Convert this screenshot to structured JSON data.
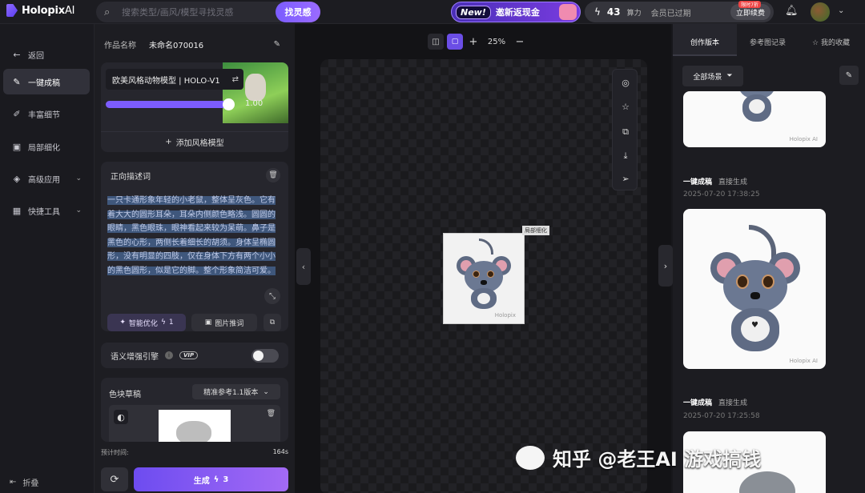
{
  "topbar": {
    "logo": "Holopix",
    "logo_ai": "AI",
    "search_placeholder": "搜索类型/画风/模型寻找灵感",
    "find_label": "找灵感",
    "promo_new": "New!",
    "promo_text": "邀新返现金",
    "credits": "43",
    "credits_label": "算力",
    "membership": "会员已过期",
    "renew_label": "立即续费",
    "renew_tag": "限时7折"
  },
  "nav": {
    "back": "返回",
    "items": [
      {
        "label": "一键成稿",
        "active": true
      },
      {
        "label": "丰富细节"
      },
      {
        "label": "局部细化"
      },
      {
        "label": "高级应用"
      },
      {
        "label": "快捷工具"
      }
    ],
    "fold": "折叠"
  },
  "panel": {
    "name_label": "作品名称",
    "name_value": "未命名070016",
    "model_name": "欧美风格动物模型 | HOLO-V1",
    "strength": 1.0,
    "strength_label": "1.00",
    "add_style": "添加风格模型",
    "prompt_title": "正向描述词",
    "prompt_text": "一只卡通形象年轻的小老鼠，整体呈灰色。它有着大大的圆形耳朵，耳朵内侧颜色略浅。圆圆的眼睛，黑色眼珠，眼神看起来较为呆萌。鼻子是黑色的心形，两侧长着细长的胡须。身体呈椭圆形，没有明显的四肢，仅在身体下方有两个小小的黑色圆形，似是它的脚。整个形象简洁可爱。",
    "optimize_label": "智能优化",
    "optimize_cost": "1",
    "img2txt_label": "图片推词",
    "semantic_label": "语义增强引擎",
    "vip": "VIP",
    "sketch_label": "色块草稿",
    "sketch_version": "精准参考1.1版本",
    "eta_label": "预计时间:",
    "eta_value": "164s",
    "generate_label": "生成",
    "generate_cost": "3"
  },
  "canvas": {
    "zoom": "25%",
    "art_tag": "局部细化",
    "art_watermark": "Holopix"
  },
  "right": {
    "tabs": [
      "创作版本",
      "参考图记录",
      "我的收藏"
    ],
    "scene_label": "全部场景",
    "cards": [
      {
        "title": "一键成稿",
        "sub": "直接生成",
        "date": "2025-07-20 17:38:25"
      },
      {
        "title": "一键成稿",
        "sub": "直接生成",
        "date": "2025-07-20 17:25:58"
      }
    ],
    "watermark": "Holopix AI"
  },
  "overlay": {
    "watermark": "知乎 @老王AI 游戏搞钱"
  },
  "colors": {
    "accent": "#7c5cff",
    "background": "#17171b",
    "panel": "#1d1d22"
  }
}
